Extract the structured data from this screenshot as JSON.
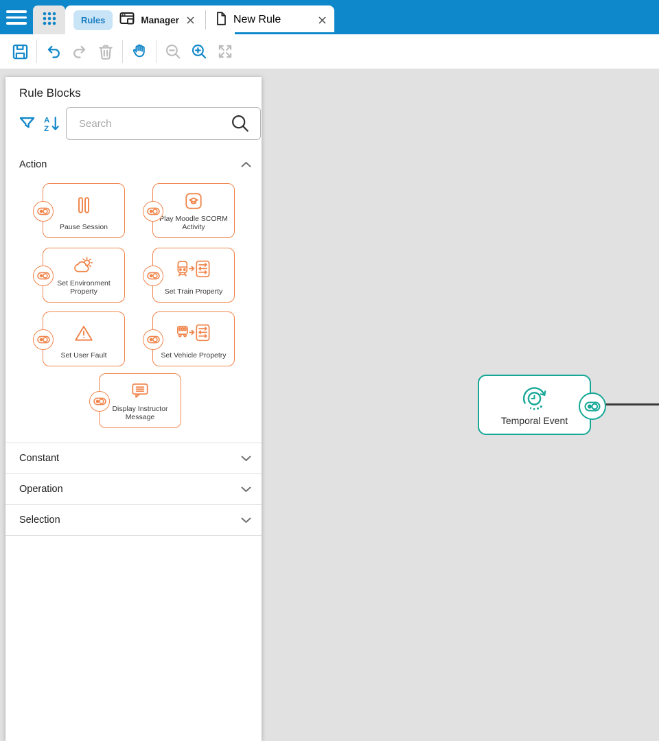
{
  "topbar": {
    "rules_label": "Rules",
    "manager_tab": {
      "label": "Manager"
    },
    "new_rule_tab": {
      "label": "New Rule"
    }
  },
  "toolbar": {
    "icons": [
      "save",
      "undo",
      "redo",
      "delete",
      "pan",
      "zoom-out",
      "zoom-in",
      "fit-view"
    ]
  },
  "panel": {
    "title": "Rule Blocks",
    "search": {
      "placeholder": "Search"
    },
    "sections": [
      {
        "label": "Action",
        "expanded": true
      },
      {
        "label": "Constant",
        "expanded": false
      },
      {
        "label": "Operation",
        "expanded": false
      },
      {
        "label": "Selection",
        "expanded": false
      }
    ],
    "action_blocks": [
      {
        "label": "Pause Session",
        "icon": "pause-icon"
      },
      {
        "label": "Play Moodle SCORM Activity",
        "icon": "graduation-cap-icon"
      },
      {
        "label": "Set Environment Property",
        "icon": "cloud-sun-icon"
      },
      {
        "label": "Set Train Property",
        "icon": "train-list-icon"
      },
      {
        "label": "Set User Fault",
        "icon": "warning-triangle-icon"
      },
      {
        "label": "Set Vehicle Propetry",
        "icon": "vehicle-list-icon"
      },
      {
        "label": "Display Instructor Message",
        "icon": "message-bubble-icon"
      }
    ]
  },
  "canvas": {
    "node": {
      "label": "Temporal Event",
      "icon": "temporal-clock-icon"
    }
  },
  "colors": {
    "accent_blue": "#0E88CA",
    "block_orange": "#F0854B",
    "node_teal": "#16A797",
    "canvas_gray": "#E1E1E1",
    "pill_blue_bg": "#C9E4F6"
  }
}
